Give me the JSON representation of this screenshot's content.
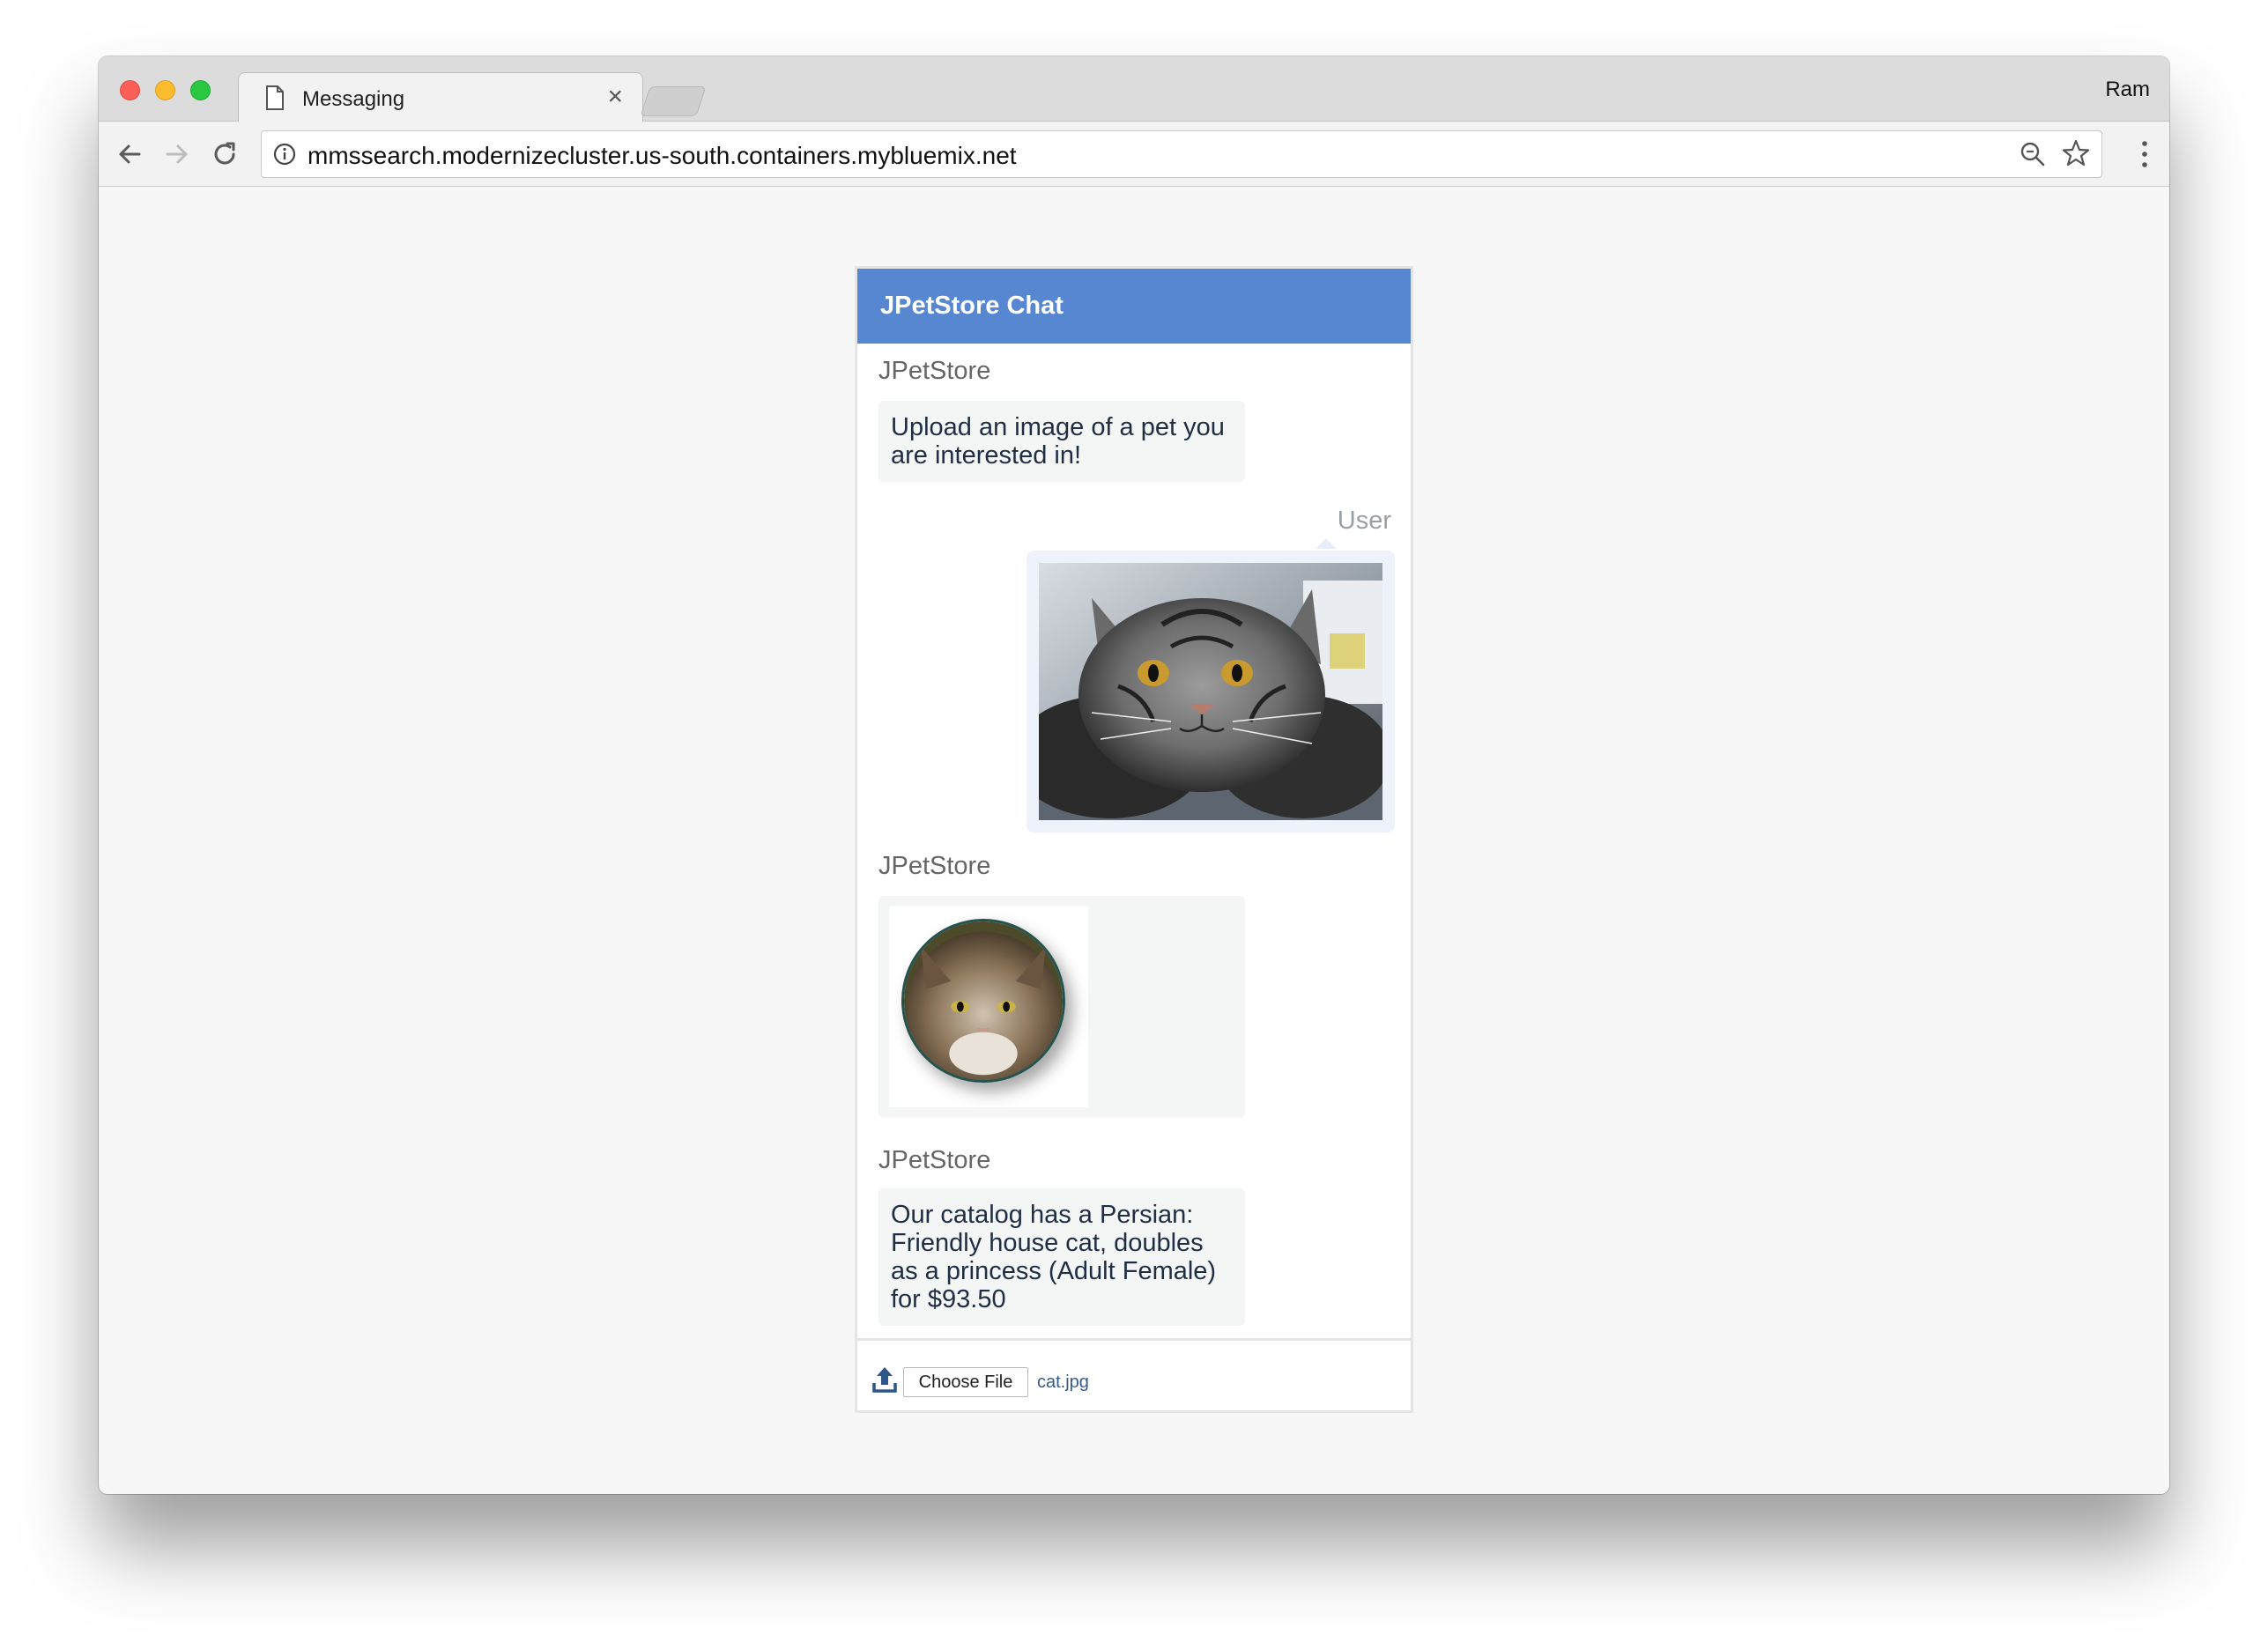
{
  "browser": {
    "tab_title": "Messaging",
    "tab_close": "×",
    "profile_name": "Ram",
    "url": "mmssearch.modernizecluster.us-south.containers.mybluemix.net"
  },
  "chat": {
    "title": "JPetStore Chat",
    "messages": [
      {
        "sender": "JPetStore",
        "text": "Upload an image of a pet you are interested in!"
      },
      {
        "sender": "User",
        "type": "image"
      },
      {
        "sender": "JPetStore",
        "type": "image"
      },
      {
        "sender": "JPetStore",
        "text": "Our catalog has a Persian: Friendly house cat, doubles as a princess (Adult Female) for $93.50"
      }
    ],
    "footer": {
      "choose_file_label": "Choose File",
      "file_name": "cat.jpg"
    }
  },
  "colors": {
    "header": "#5787d1",
    "bubble": "#f4f5f5",
    "user_bubble": "#eef3fb"
  }
}
